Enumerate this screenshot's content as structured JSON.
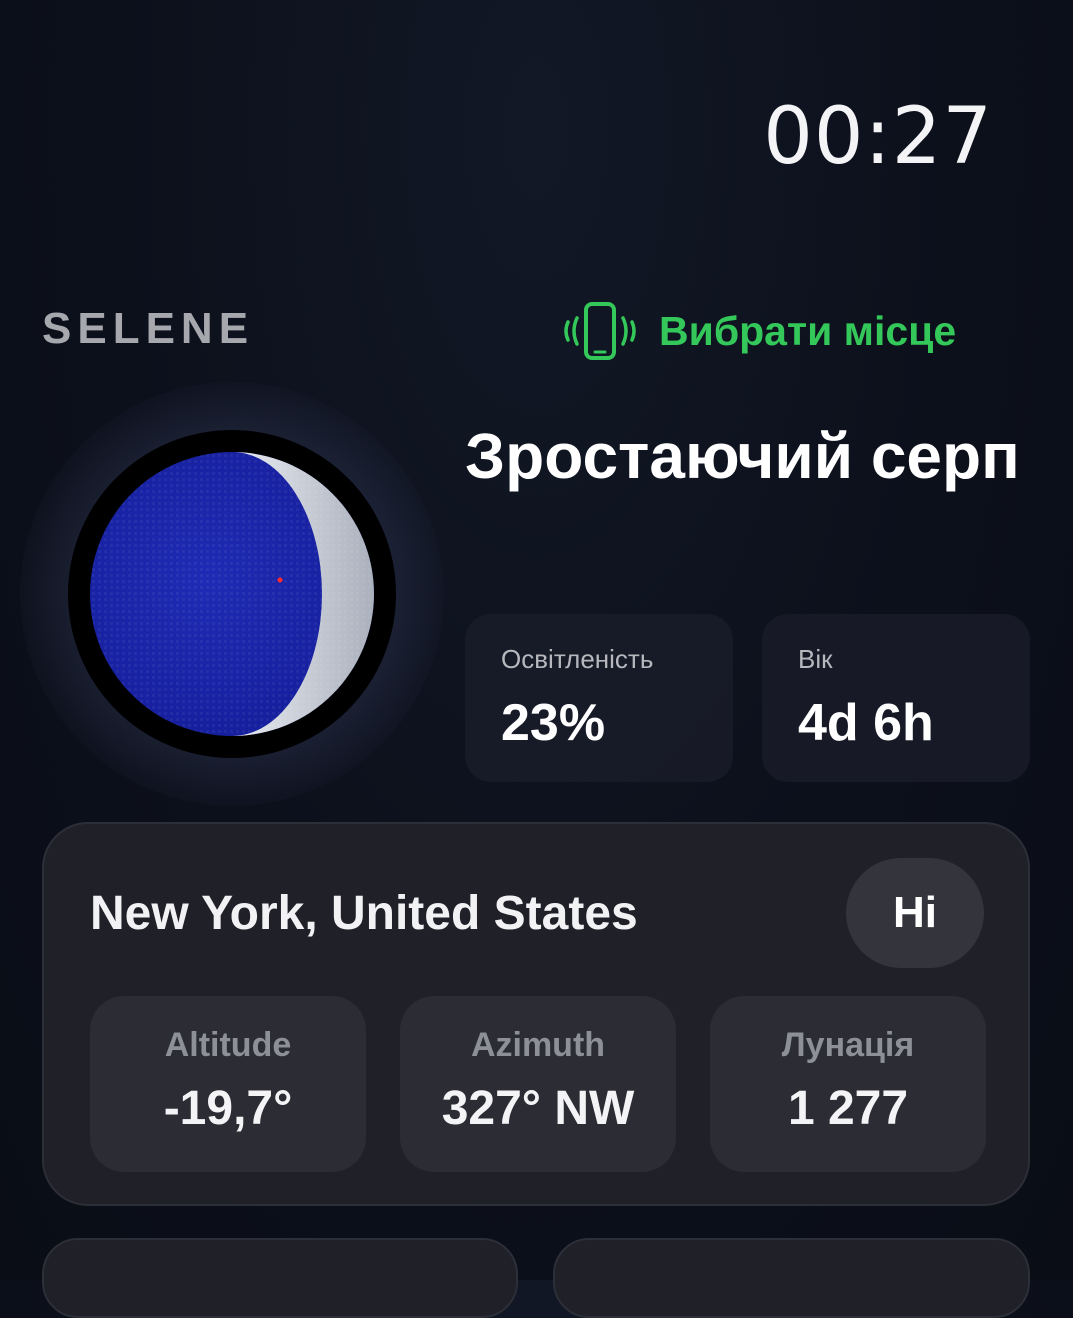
{
  "status": {
    "time": "00:27"
  },
  "header": {
    "app_name": "SELENE",
    "choose_place_label": "Вибрати місце",
    "choose_place_icon": "phone-vibrate-icon",
    "accent_color": "#34c759"
  },
  "moon": {
    "phase_name": "Зростаючий серп",
    "illumination": {
      "label": "Освітленість",
      "value": "23%"
    },
    "age": {
      "label": "Вік",
      "value": "4d 6h"
    },
    "illuminated_fraction": 0.23
  },
  "location": {
    "title": "New York, United States",
    "lang_button": "Hi",
    "metrics": [
      {
        "label": "Altitude",
        "value": "-19,7°"
      },
      {
        "label": "Azimuth",
        "value": "327° NW"
      },
      {
        "label": "Лунація",
        "value": "1 277"
      }
    ]
  }
}
